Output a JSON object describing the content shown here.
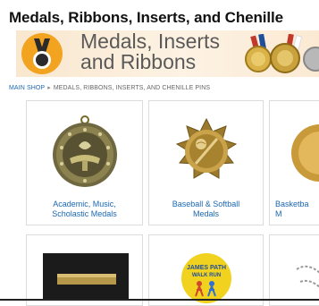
{
  "page": {
    "title": "Medals, Ribbons, Inserts, and Chenille"
  },
  "banner": {
    "line1": "Medals, Inserts",
    "line2": "and Ribbons",
    "accent_color": "#f2a320"
  },
  "breadcrumb": {
    "home": "MAIN SHOP",
    "separator": "▸",
    "current": "MEDALS, RIBBONS, INSERTS, AND CHENILLE PINS"
  },
  "categories": [
    {
      "line1": "Academic, Music,",
      "line2": "Scholastic Medals",
      "icon": "academic-medal-icon"
    },
    {
      "line1": "Baseball & Softball",
      "line2": "Medals",
      "icon": "baseball-medal-icon"
    },
    {
      "line1": "Basketba",
      "line2": "M",
      "icon": "basketball-medal-icon"
    },
    {
      "icon": "gold-insert-plate-icon"
    },
    {
      "icon": "walk-run-medal-icon",
      "medal_text": [
        "JAMES PATH",
        "WALK RUN"
      ]
    },
    {
      "icon": "chain-ribbon-icon"
    }
  ],
  "colors": {
    "link": "#1b67b2",
    "border": "#dcdcdc"
  }
}
